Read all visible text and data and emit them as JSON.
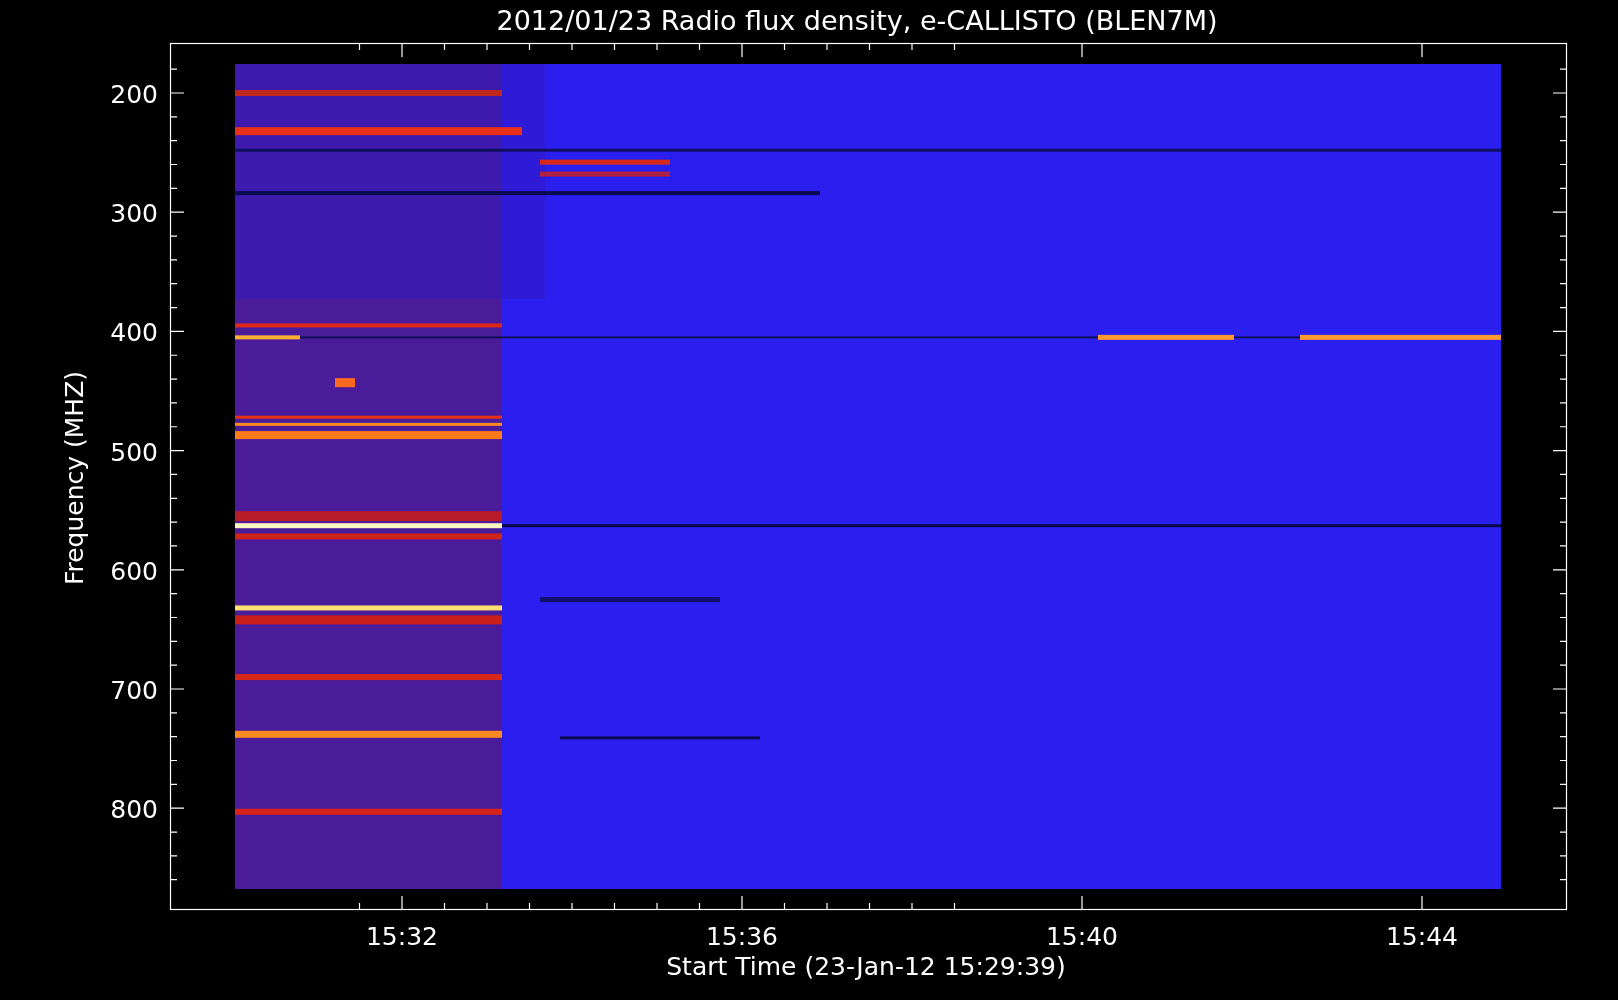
{
  "title": "2012/01/23  Radio flux density, e-CALLISTO (BLEN7M)",
  "ylabel": "Frequency (MHZ)",
  "xlabel": "Start Time (23-Jan-12 15:29:39)",
  "yticks": [
    "200",
    "300",
    "400",
    "500",
    "600",
    "700",
    "800"
  ],
  "xticks": [
    "15:32",
    "15:36",
    "15:40",
    "15:44"
  ]
}
